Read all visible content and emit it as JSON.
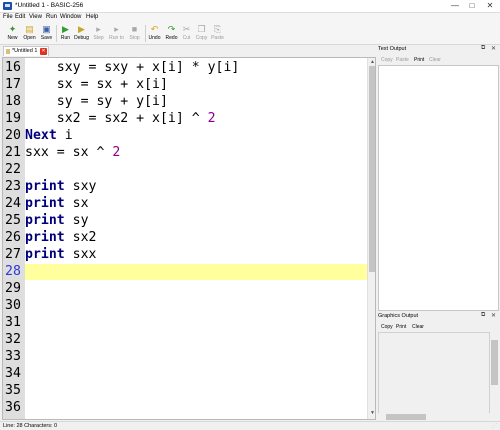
{
  "window": {
    "title": "*Untitled 1 - BASIC-256",
    "minimize_glyph": "—",
    "maximize_glyph": "□",
    "close_glyph": "✕"
  },
  "menu": [
    "File",
    "Edit",
    "View",
    "Run",
    "Window",
    "Help"
  ],
  "toolbar": {
    "buttons": [
      {
        "label": "New",
        "icon": "new-icon",
        "glyph": "✦",
        "color": "#3a8f3a",
        "enabled": true
      },
      {
        "label": "Open",
        "icon": "open-icon",
        "glyph": "▤",
        "color": "#d6a520",
        "enabled": true
      },
      {
        "label": "Save",
        "icon": "save-icon",
        "glyph": "▣",
        "color": "#3b5fa8",
        "enabled": true
      },
      {
        "label": "Run",
        "icon": "run-icon",
        "glyph": "▶",
        "color": "#2f9e2f",
        "enabled": true
      },
      {
        "label": "Debug",
        "icon": "debug-icon",
        "glyph": "▶",
        "color": "#c8a62a",
        "enabled": true
      },
      {
        "label": "Step",
        "icon": "step-icon",
        "glyph": "▸",
        "color": "#a8a8a8",
        "enabled": false
      },
      {
        "label": "Run to",
        "icon": "run-to-icon",
        "glyph": "▸",
        "color": "#a8a8a8",
        "enabled": false
      },
      {
        "label": "Stop",
        "icon": "stop-icon",
        "glyph": "■",
        "color": "#a8a8a8",
        "enabled": false
      },
      {
        "label": "Undo",
        "icon": "undo-icon",
        "glyph": "↶",
        "color": "#d6a520",
        "enabled": true
      },
      {
        "label": "Redo",
        "icon": "redo-icon",
        "glyph": "↷",
        "color": "#2f9e2f",
        "enabled": true
      },
      {
        "label": "Cut",
        "icon": "cut-icon",
        "glyph": "✂",
        "color": "#a8a8a8",
        "enabled": false
      },
      {
        "label": "Copy",
        "icon": "copy-icon",
        "glyph": "❐",
        "color": "#a8a8a8",
        "enabled": false
      },
      {
        "label": "Paste",
        "icon": "paste-icon",
        "glyph": "⎘",
        "color": "#a8a8a8",
        "enabled": false
      }
    ]
  },
  "tab": {
    "label": "*Untitled 1",
    "close_glyph": "✕"
  },
  "editor": {
    "current_line": 28,
    "lines": [
      {
        "num": "16",
        "text": "    sxy = sxy + x[i] * y[i]"
      },
      {
        "num": "17",
        "text": "    sx = sx + x[i]"
      },
      {
        "num": "18",
        "text": "    sy = sy + y[i]"
      },
      {
        "num": "19",
        "text": "    sx2 = sx2 + x[i] ^ 2"
      },
      {
        "num": "20",
        "text": "Next i"
      },
      {
        "num": "21",
        "text": "sxx = sx ^ 2"
      },
      {
        "num": "22",
        "text": ""
      },
      {
        "num": "23",
        "text": "print sxy"
      },
      {
        "num": "24",
        "text": "print sx"
      },
      {
        "num": "25",
        "text": "print sy"
      },
      {
        "num": "26",
        "text": "print sx2"
      },
      {
        "num": "27",
        "text": "print sxx"
      },
      {
        "num": "28",
        "text": ""
      },
      {
        "num": "29",
        "text": ""
      },
      {
        "num": "30",
        "text": ""
      },
      {
        "num": "31",
        "text": ""
      },
      {
        "num": "32",
        "text": ""
      },
      {
        "num": "33",
        "text": ""
      },
      {
        "num": "34",
        "text": ""
      },
      {
        "num": "35",
        "text": ""
      },
      {
        "num": "36",
        "text": ""
      }
    ],
    "keywords": [
      "Next",
      "print"
    ],
    "colors": {
      "keyword": "#00007f",
      "number": "#8b008b",
      "current_line_bg": "#ffff9e",
      "current_line_number": "#2c3ad6"
    }
  },
  "text_output": {
    "title": "Text Output",
    "tools": [
      {
        "label": "Copy",
        "enabled": false
      },
      {
        "label": "Paste",
        "enabled": false
      },
      {
        "label": "Print",
        "enabled": true
      },
      {
        "label": "Clear",
        "enabled": false
      }
    ]
  },
  "graphics_output": {
    "title": "Graphics Output",
    "tools": [
      {
        "label": "Copy",
        "enabled": true
      },
      {
        "label": "Print",
        "enabled": true
      },
      {
        "label": "Clear",
        "enabled": true
      }
    ]
  },
  "panel_controls": {
    "float_glyph": "⧉",
    "close_glyph": "✕"
  },
  "status": {
    "text": "Line: 28 Characters: 0"
  }
}
